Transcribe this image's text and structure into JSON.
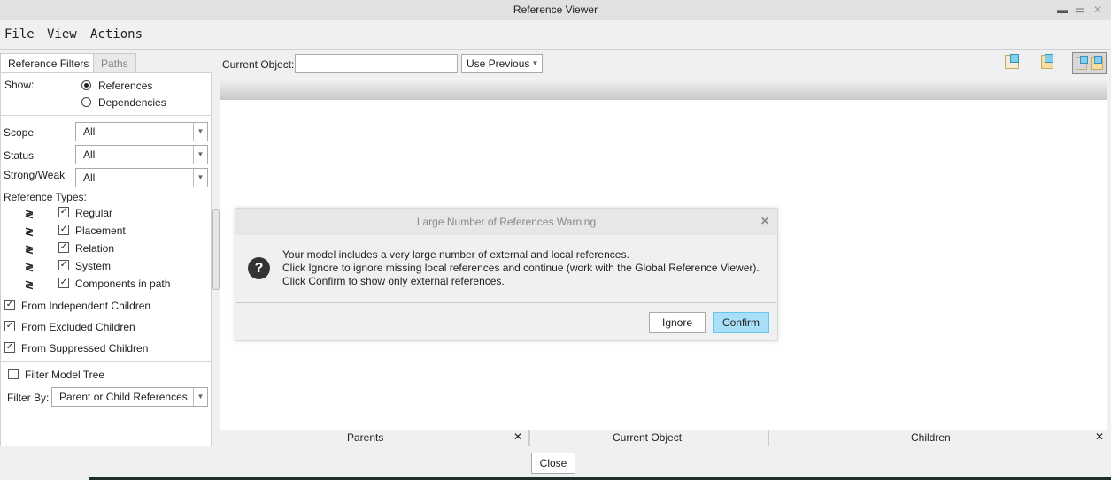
{
  "window": {
    "title": "Reference Viewer"
  },
  "menu": [
    "File",
    "View",
    "Actions"
  ],
  "tabs": [
    "Reference Filters",
    "Paths"
  ],
  "filters": {
    "show_label": "Show:",
    "show_options": [
      {
        "label": "References",
        "selected": true
      },
      {
        "label": "Dependencies",
        "selected": false
      }
    ],
    "scope_label": "Scope",
    "scope_value": "All",
    "status_label": "Status",
    "status_value": "All",
    "strong_label": "Strong/Weak",
    "strong_value": "All",
    "types_label": "Reference Types:",
    "types": [
      {
        "label": "Regular",
        "checked": true
      },
      {
        "label": "Placement",
        "checked": true
      },
      {
        "label": "Relation",
        "checked": true
      },
      {
        "label": "System",
        "checked": true
      },
      {
        "label": "Components in path",
        "checked": true
      }
    ],
    "children": [
      {
        "label": "From Independent Children",
        "checked": true
      },
      {
        "label": "From Excluded Children",
        "checked": true
      },
      {
        "label": "From Suppressed Children",
        "checked": true
      }
    ],
    "filter_tree_label": "Filter Model Tree",
    "filter_tree_checked": false,
    "filter_by_label": "Filter By:",
    "filter_by_value": "Parent or Child References"
  },
  "toolbar": {
    "current_object_label": "Current Object:",
    "current_object_value": "",
    "use_previous": "Use Previous"
  },
  "bottom_tabs": [
    "Parents",
    "Current Object",
    "Children"
  ],
  "close_label": "Close",
  "dialog": {
    "title": "Large Number of References Warning",
    "lines": [
      "Your model includes a very large number of external and local references.",
      "Click Ignore to ignore missing local references and continue (work with the Global Reference Viewer).",
      "Click Confirm to show only external references."
    ],
    "ignore": "Ignore",
    "confirm": "Confirm"
  }
}
